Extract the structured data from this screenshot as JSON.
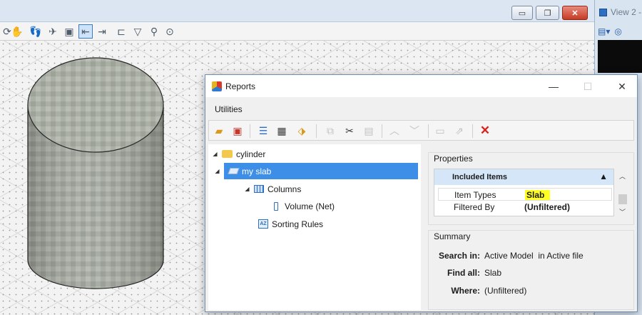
{
  "cad": {
    "window_buttons": {
      "minimize": "▭",
      "restore": "❐",
      "close": "✕"
    },
    "toolbar_icons": [
      "rotate-view-icon",
      "pan-hand-icon",
      "walk-icon",
      "fly-icon",
      "view-previous-icon",
      "view-next-icon",
      "copy-view-icon",
      "clip-volume-icon",
      "zoom-icon",
      "fit-view-icon"
    ]
  },
  "view2": {
    "title": "View 2 -"
  },
  "reports": {
    "title": "Reports",
    "caption": {
      "minimize": "—",
      "maximize": "☐",
      "close": "✕"
    },
    "menu": {
      "utilities": "Utilities"
    },
    "tree": {
      "root": "cylinder",
      "report": "my slab",
      "columns": "Columns",
      "column_item": "Volume (Net)",
      "sorting": "Sorting Rules"
    },
    "properties": {
      "label": "Properties",
      "group": "Included Items",
      "rows": [
        {
          "key": "Item Types",
          "value": "Slab"
        },
        {
          "key": "Filtered By",
          "value": "(Unfiltered)"
        }
      ]
    },
    "summary": {
      "label": "Summary",
      "search_key": "Search in:",
      "search_val": "Active Model  in Active file",
      "find_key": "Find all:",
      "find_val": "Slab",
      "where_key": "Where:",
      "where_val": "(Unfiltered)"
    }
  },
  "colors": {
    "selection": "#3d8ee6",
    "highlight": "#ffff21",
    "delete": "#d9231f",
    "group_header": "#d4e6f8"
  }
}
